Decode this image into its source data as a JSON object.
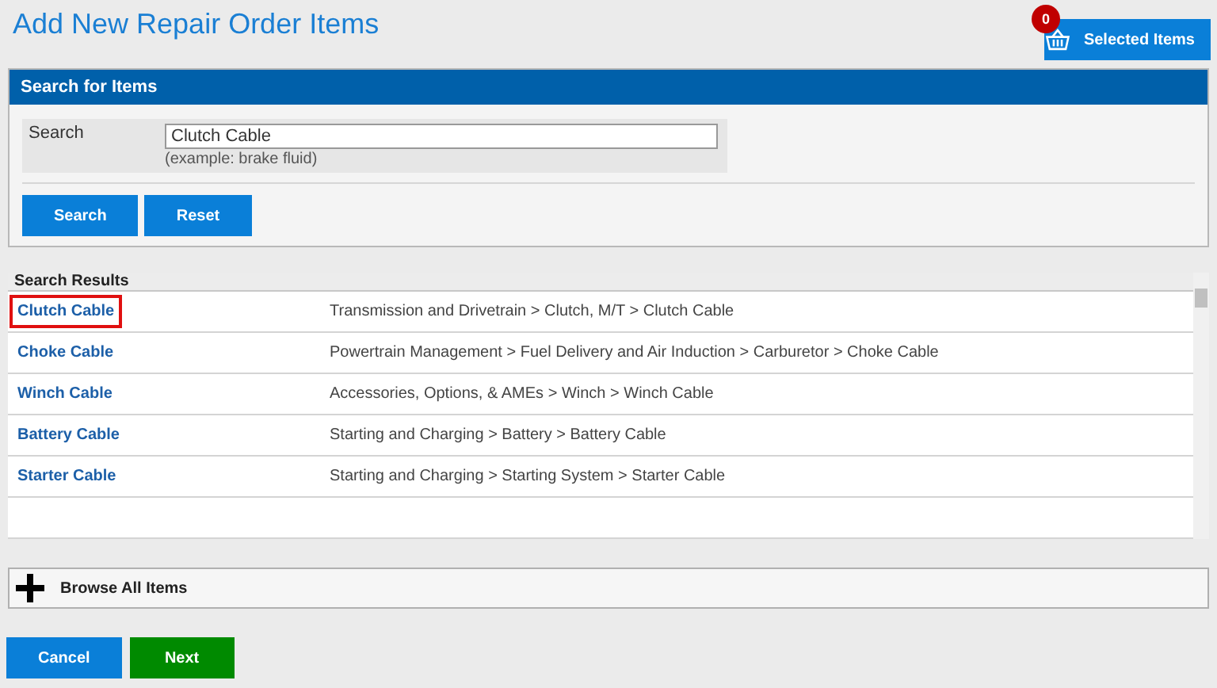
{
  "page_title": "Add New Repair Order Items",
  "selected_items": {
    "label": "Selected Items",
    "count": "0"
  },
  "search_panel": {
    "title": "Search for Items",
    "field_label": "Search",
    "value": "Clutch Cable",
    "hint": "(example: brake fluid)",
    "buttons": [
      "Search",
      "Reset"
    ]
  },
  "results": {
    "title": "Search Results",
    "rows": [
      {
        "name": "Clutch Cable",
        "path": "Transmission and Drivetrain > Clutch, M/T > Clutch Cable",
        "selected": true
      },
      {
        "name": "Choke Cable",
        "path": "Powertrain Management > Fuel Delivery and Air Induction > Carburetor > Choke Cable",
        "selected": false
      },
      {
        "name": "Winch Cable",
        "path": "Accessories, Options, & AMEs > Winch > Winch Cable",
        "selected": false
      },
      {
        "name": "Battery Cable",
        "path": "Starting and Charging > Battery > Battery Cable",
        "selected": false
      },
      {
        "name": "Starter Cable",
        "path": "Starting and Charging > Starting System > Starter Cable",
        "selected": false
      }
    ]
  },
  "browse": {
    "label": "Browse All Items"
  },
  "footer_buttons": [
    {
      "label": "Cancel",
      "kind": "secondary"
    },
    {
      "label": "Next",
      "kind": "primary"
    }
  ]
}
